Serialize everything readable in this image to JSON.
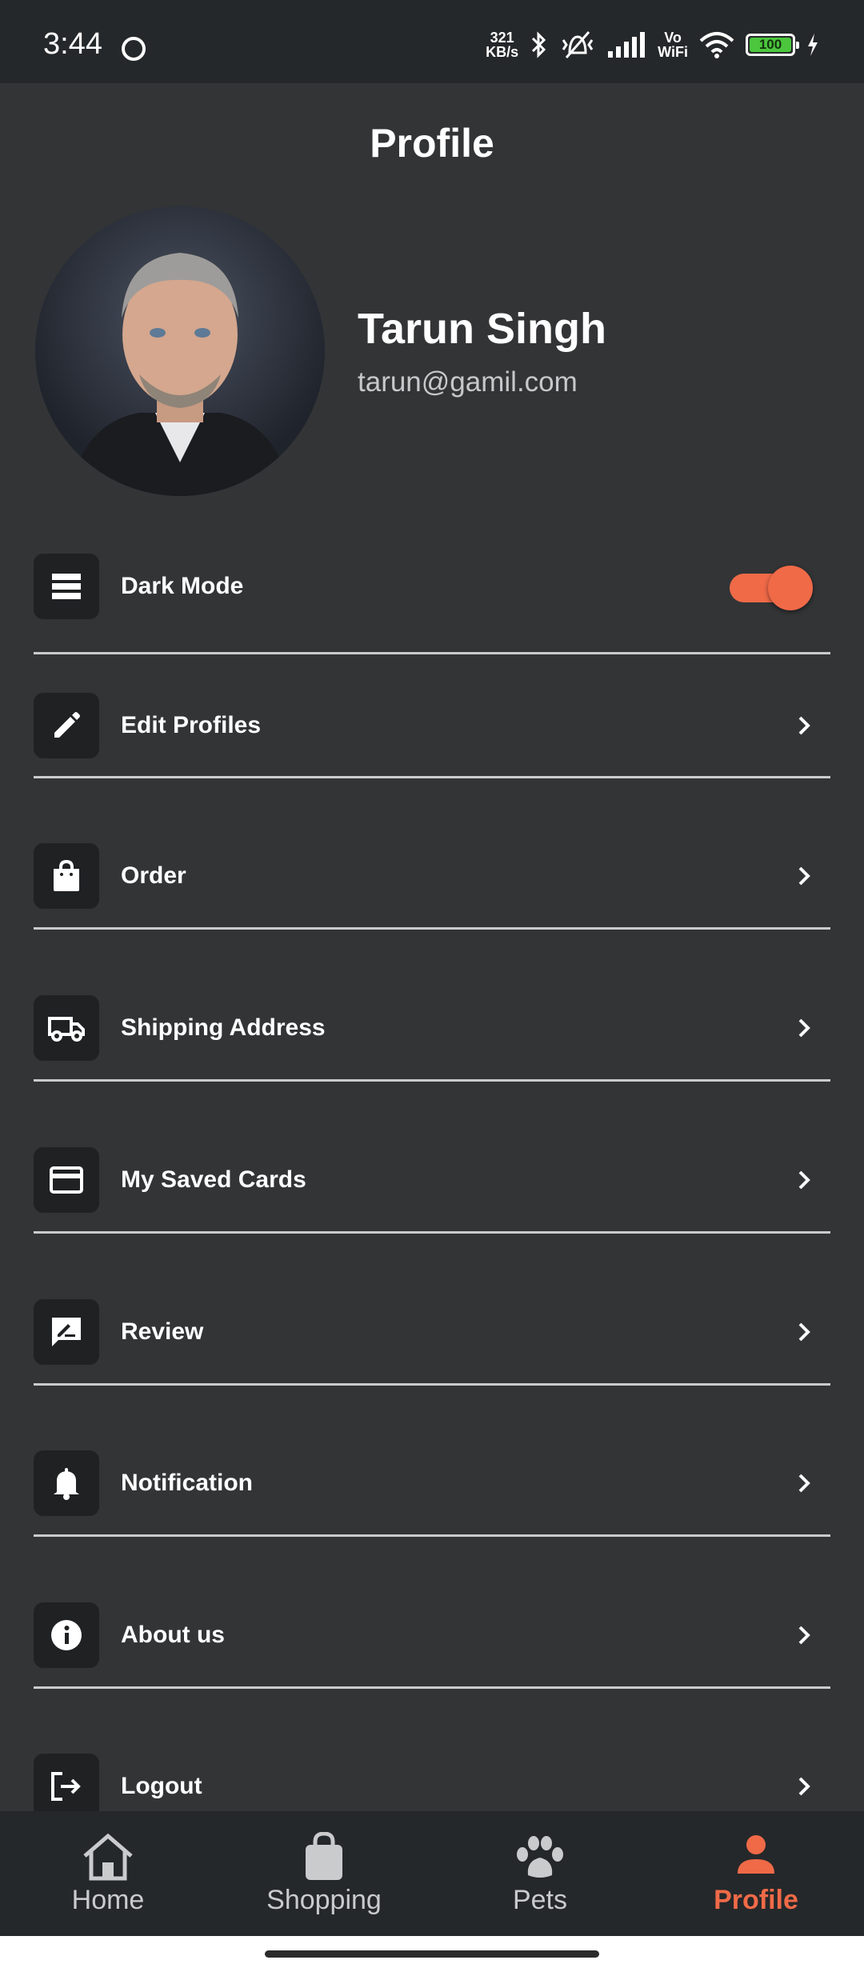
{
  "status_bar": {
    "time": "3:44",
    "net_speed_value": "321",
    "net_speed_unit": "KB/s",
    "vo_line1": "Vo",
    "vo_line2": "WiFi",
    "battery": "100"
  },
  "header": {
    "title": "Profile"
  },
  "profile": {
    "name": "Tarun Singh",
    "email": "tarun@gamil.com"
  },
  "menu": {
    "dark_mode": {
      "label": "Dark Mode",
      "enabled": true
    },
    "items": [
      {
        "label": "Edit Profiles",
        "icon": "pencil-icon"
      },
      {
        "label": "Order",
        "icon": "bag-icon"
      },
      {
        "label": "Shipping Address",
        "icon": "truck-icon"
      },
      {
        "label": "My Saved Cards",
        "icon": "card-icon"
      },
      {
        "label": "Review",
        "icon": "review-icon"
      },
      {
        "label": "Notification",
        "icon": "bell-icon"
      },
      {
        "label": "About us",
        "icon": "info-icon"
      },
      {
        "label": "Logout",
        "icon": "logout-icon"
      }
    ]
  },
  "bottom_nav": {
    "items": [
      {
        "label": "Home",
        "active": false
      },
      {
        "label": "Shopping",
        "active": false
      },
      {
        "label": "Pets",
        "active": false
      },
      {
        "label": "Profile",
        "active": true
      }
    ]
  },
  "colors": {
    "background": "#323436",
    "accent": "#f06a48",
    "bar": "#25282a"
  }
}
